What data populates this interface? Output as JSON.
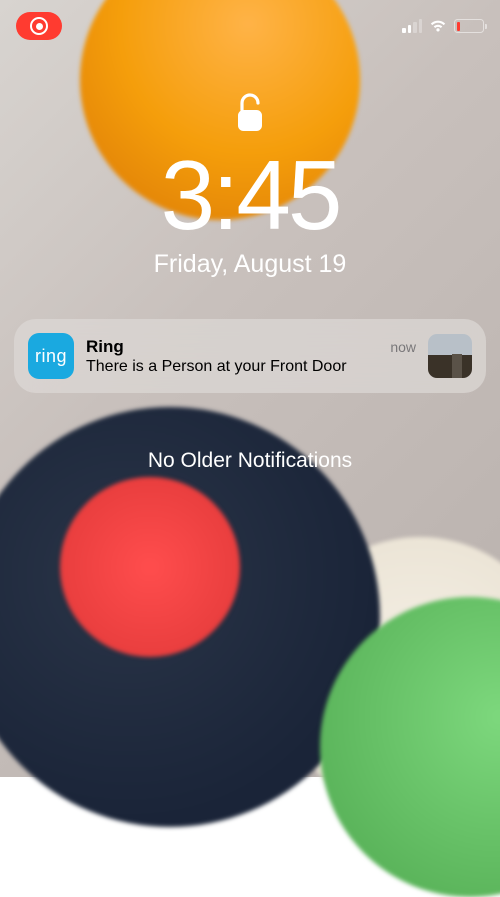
{
  "status_bar": {
    "screen_recording": true,
    "cellular_bars_active": 2,
    "cellular_bars_total": 4,
    "wifi_active": true,
    "battery_percent": 15,
    "battery_low": true
  },
  "lock_screen": {
    "locked": false,
    "time": "3:45",
    "date": "Friday, August 19"
  },
  "notification": {
    "app_icon_text": "ring",
    "app_name": "Ring",
    "timestamp": "now",
    "message": "There is a Person at your Front Door",
    "thumbnail_desc": "front-door-camera"
  },
  "footer": {
    "no_older_text": "No Older Notifications"
  },
  "colors": {
    "accent_red": "#ff3b30",
    "ring_blue": "#1aa9e0"
  }
}
